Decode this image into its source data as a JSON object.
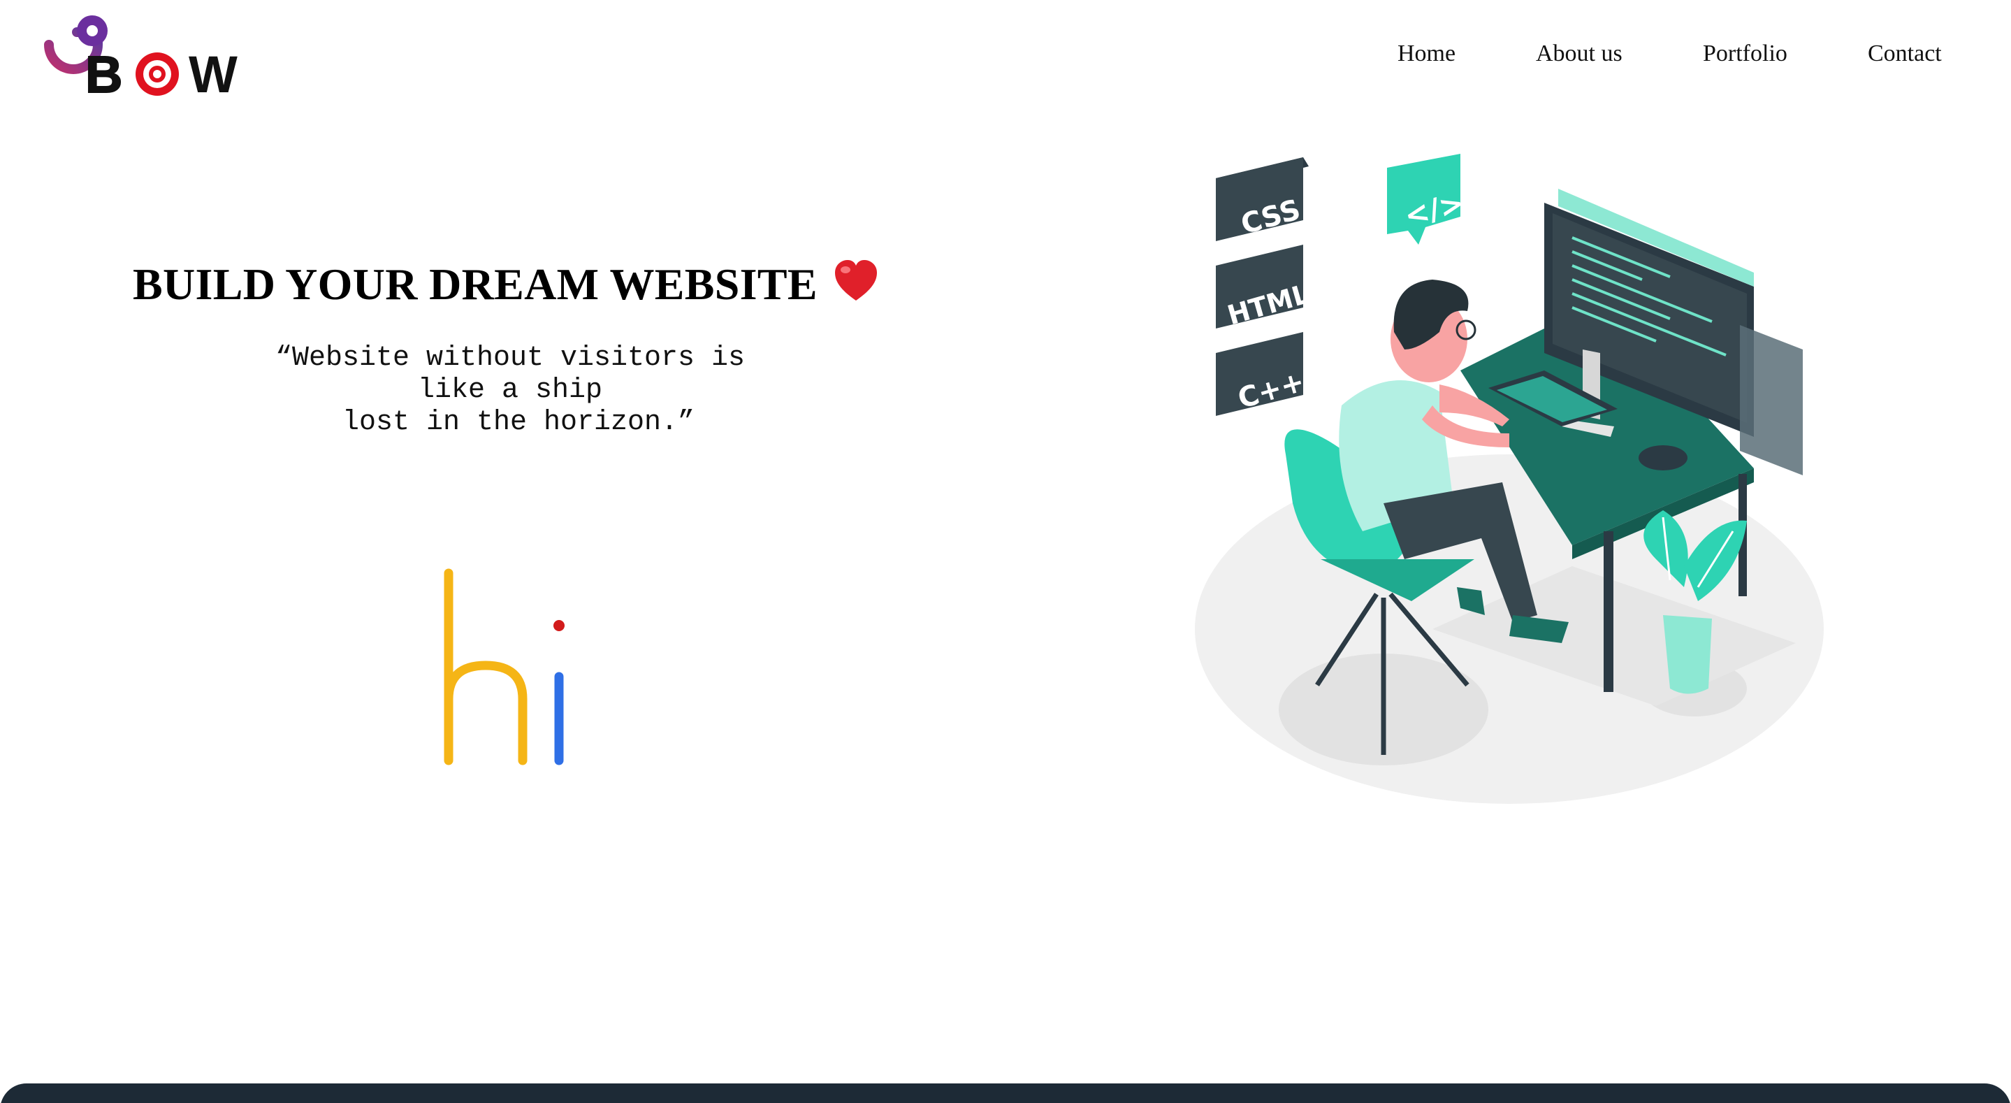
{
  "brand": {
    "name": "BOW",
    "letters": [
      "B",
      "O",
      "W"
    ]
  },
  "nav": {
    "items": [
      {
        "label": "Home"
      },
      {
        "label": "About us"
      },
      {
        "label": "Portfolio"
      },
      {
        "label": "Contact"
      }
    ]
  },
  "hero": {
    "headline": "BUILD YOUR DREAM WEBSITE",
    "headline_icon": "red-heart-emoji",
    "quote_lines": [
      "“Website without visitors is",
      "like a ship",
      " lost in the horizon.”"
    ],
    "hi_text": "hi"
  },
  "illustration": {
    "badges": [
      "CSS",
      "HTML",
      "C++"
    ],
    "speech_bubble": "</>",
    "subject": "developer-at-desk-illustration"
  },
  "colors": {
    "teal": "#2ed3b3",
    "dark_teal": "#1b7264",
    "navy": "#37474f",
    "heart_red": "#e0202a",
    "logo_purple": "#6b2f9e",
    "logo_magenta": "#b02c6e",
    "hi_yellow": "#f5b516",
    "hi_blue": "#2f6fe6",
    "hi_dot_red": "#d21b1b",
    "footer": "#1d2a36"
  }
}
